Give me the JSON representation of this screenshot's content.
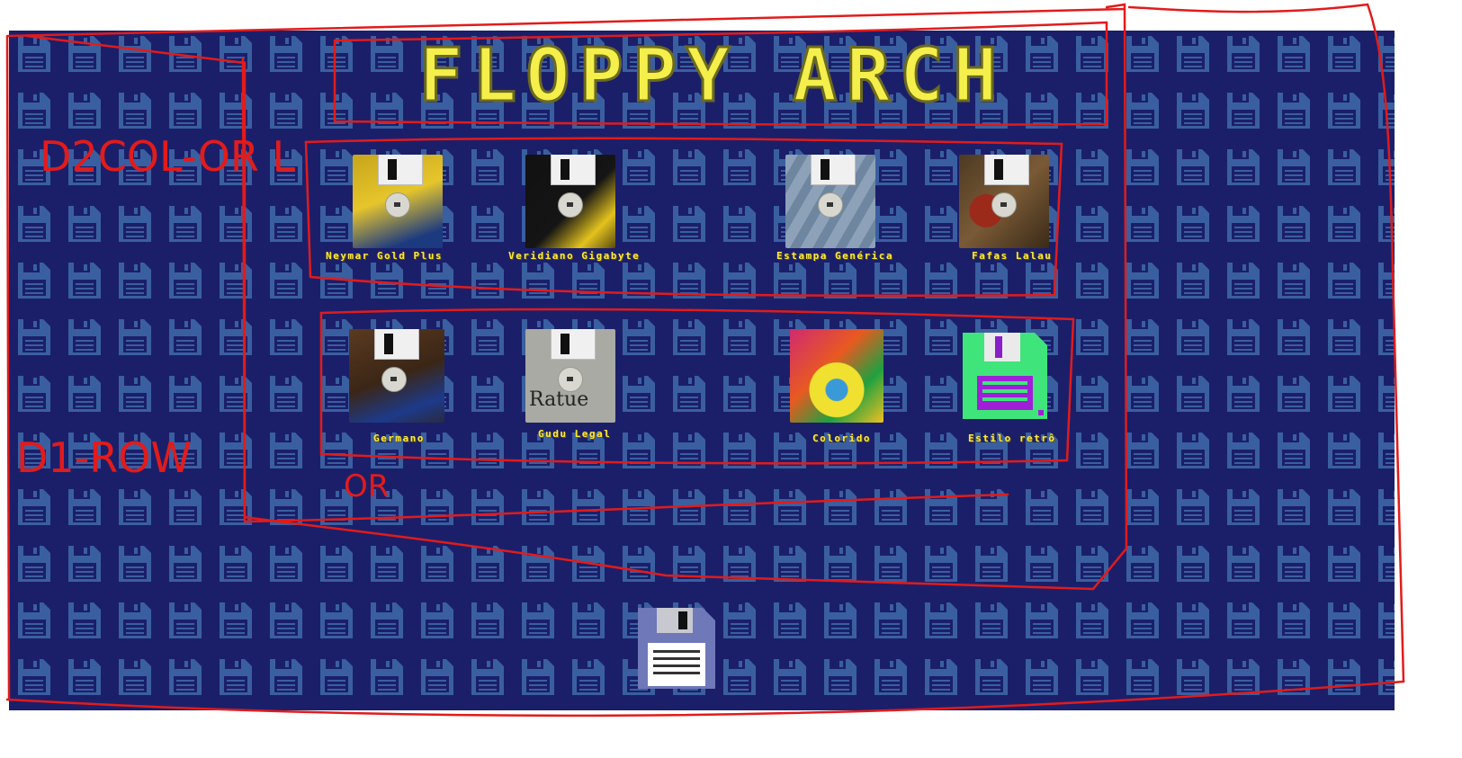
{
  "app": {
    "title": "FLOPPY ARCH"
  },
  "colors": {
    "background": "#1b1f6a",
    "pattern": "#3a5fa0",
    "title_fill": "#f4ef4a",
    "label": "#ffea3a",
    "annotation": "#e21b1b"
  },
  "rows": [
    {
      "items": [
        {
          "label": "Neymar Gold Plus",
          "art": "yellow-photo"
        },
        {
          "label": "Veridiano Gigabyte",
          "art": "black-photo"
        },
        {
          "label": "Estampa Genérica",
          "art": "zebra-gray"
        },
        {
          "label": "Fafas Lalau",
          "art": "collage"
        }
      ]
    },
    {
      "items": [
        {
          "label": "Germano",
          "art": "dark-photo"
        },
        {
          "label": "Gudu Legal",
          "art": "ratue-gray"
        },
        {
          "label": "Colorido",
          "art": "colorful"
        },
        {
          "label": "Estilo retrô",
          "art": "retro-green"
        }
      ]
    }
  ],
  "add_button": {
    "icon": "floppy-disk-icon"
  },
  "annotations": {
    "col_note": "D2COL-OR L",
    "row_note": "D1-ROW",
    "row2_note": "OR"
  }
}
